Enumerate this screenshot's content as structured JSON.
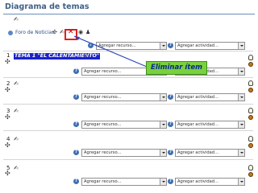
{
  "page_title": "Diagrama de temas",
  "forum": {
    "label": "Foro de Noticias"
  },
  "theme1": {
    "label": "TEMA 1 \"EL CALENTAMIENTO\""
  },
  "callout": {
    "text": "Eliminar ítem"
  },
  "select": {
    "resource": "Agregar recurso...",
    "activity": "Agregar actividad..."
  },
  "sections": [
    {
      "number": "1"
    },
    {
      "number": "2"
    },
    {
      "number": "3"
    },
    {
      "number": "4"
    },
    {
      "number": "5"
    }
  ],
  "colors": {
    "title": "#3f5f86",
    "highlight": "#1a22c8",
    "callout_bg": "#79d13e",
    "delete_box": "#e02020"
  }
}
